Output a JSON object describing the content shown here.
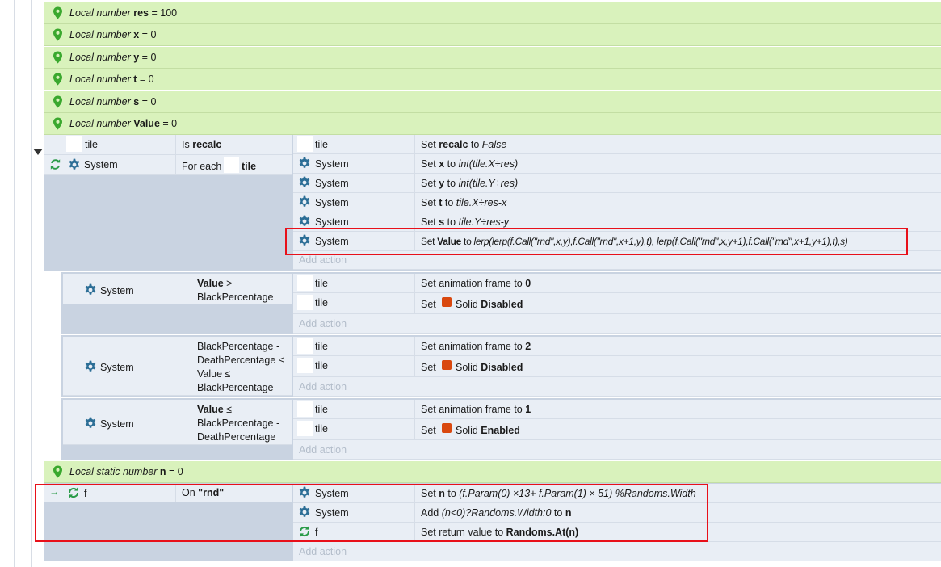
{
  "variables": [
    {
      "prefix": "Local number",
      "name": "res",
      "value": "= 100"
    },
    {
      "prefix": "Local number",
      "name": "x",
      "value": "= 0"
    },
    {
      "prefix": "Local number",
      "name": "y",
      "value": "= 0"
    },
    {
      "prefix": "Local number",
      "name": "t",
      "value": "= 0"
    },
    {
      "prefix": "Local number",
      "name": "s",
      "value": "= 0"
    },
    {
      "prefix": "Local number",
      "name": "Value",
      "value": "= 0"
    }
  ],
  "event1": {
    "conditions": [
      {
        "object": "tile",
        "text_a": "Is ",
        "text_b": "recalc"
      },
      {
        "object": "System",
        "text_a": "For each",
        "text_b": "tile"
      }
    ],
    "actions": [
      {
        "object": "tile",
        "pre": "Set ",
        "b": "recalc",
        "mid": " to ",
        "it": "False"
      },
      {
        "object": "System",
        "pre": "Set ",
        "b": "x",
        "mid": " to ",
        "it": "int(tile.X÷res)"
      },
      {
        "object": "System",
        "pre": "Set ",
        "b": "y",
        "mid": " to ",
        "it": "int(tile.Y÷res)"
      },
      {
        "object": "System",
        "pre": "Set ",
        "b": "t",
        "mid": " to ",
        "it": "tile.X÷res-x"
      },
      {
        "object": "System",
        "pre": "Set ",
        "b": "s",
        "mid": " to ",
        "it": "tile.Y÷res-y"
      },
      {
        "object": "System",
        "pre": "Set ",
        "b": "Value",
        "mid": " to ",
        "it": "lerp(lerp(f.Call(\"rnd\",x,y),f.Call(\"rnd\",x+1,y),t), lerp(f.Call(\"rnd\",x,y+1),f.Call(\"rnd\",x+1,y+1),t),s)"
      }
    ],
    "add_action": "Add action"
  },
  "sub1": {
    "object": "System",
    "cond_b": "Value",
    "cond_1": " >",
    "cond_2": "BlackPercentage",
    "actions": [
      {
        "object": "tile",
        "pre": "Set animation frame to ",
        "b": "0"
      },
      {
        "object": "tile",
        "pre": "Set",
        "mid": "Solid",
        "b": "Disabled"
      }
    ],
    "add_action": "Add action"
  },
  "sub2": {
    "object": "System",
    "cond_lines": [
      "BlackPercentage -",
      "DeathPercentage ≤",
      "Value ≤",
      "BlackPercentage"
    ],
    "actions": [
      {
        "object": "tile",
        "pre": "Set animation frame to ",
        "b": "2"
      },
      {
        "object": "tile",
        "pre": "Set",
        "mid": "Solid",
        "b": "Disabled"
      }
    ],
    "add_action": "Add action"
  },
  "sub3": {
    "object": "System",
    "cond_b": "Value",
    "cond_1": " ≤",
    "cond_2": "BlackPercentage -",
    "cond_3": "DeathPercentage",
    "actions": [
      {
        "object": "tile",
        "pre": "Set animation frame to ",
        "b": "1"
      },
      {
        "object": "tile",
        "pre": "Set",
        "mid": "Solid",
        "b": "Enabled"
      }
    ],
    "add_action": "Add action"
  },
  "static_var": {
    "prefix": "Local static number",
    "name": "n",
    "value": "= 0"
  },
  "func": {
    "object": "f",
    "cond_a": "On ",
    "cond_b": "\"rnd\"",
    "actions": [
      {
        "object": "System",
        "pre": "Set ",
        "b": "n",
        "mid": " to ",
        "it": "(f.Param(0) ×13+ f.Param(1) × 51) %Randoms.Width"
      },
      {
        "object": "System",
        "pre": "Add ",
        "it": "(n<0)?Randoms.Width:0",
        "mid": " to ",
        "b": "n"
      },
      {
        "object": "f",
        "pre": "Set return value to ",
        "b": "Randoms.At(n)"
      }
    ],
    "add_action": "Add action"
  },
  "colors": {
    "variable_bg": "#d9f2bc",
    "block_bg": "#c9d3e1",
    "row_bg": "#e9eef5",
    "gear": "#2c6e96",
    "highlight": "#e8101a",
    "solid_swatch": "#d9480f"
  }
}
